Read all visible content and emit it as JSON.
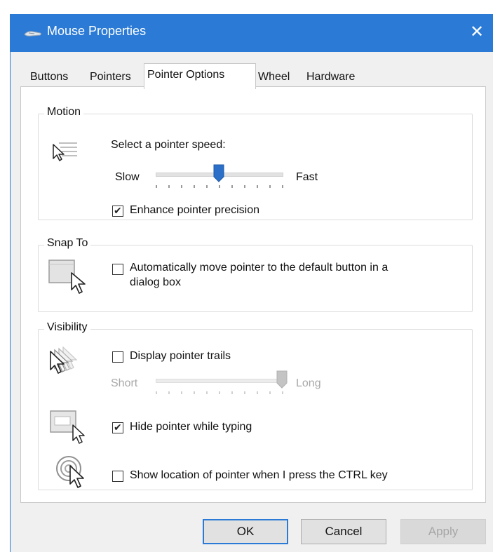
{
  "window": {
    "title": "Mouse Properties",
    "close_glyph": "✕"
  },
  "tabs": [
    {
      "label": "Buttons",
      "active": false
    },
    {
      "label": "Pointers",
      "active": false
    },
    {
      "label": "Pointer Options",
      "active": true
    },
    {
      "label": "Wheel",
      "active": false
    },
    {
      "label": "Hardware",
      "active": false
    }
  ],
  "motion": {
    "group_label": "Motion",
    "speed_prompt": "Select a pointer speed:",
    "slow_label": "Slow",
    "fast_label": "Fast",
    "speed_fraction": 0.5,
    "enhance_label": "Enhance pointer precision",
    "enhance_checked": true
  },
  "snap_to": {
    "group_label": "Snap To",
    "auto_move_label_line1": "Automatically move pointer to the default button in a",
    "auto_move_label_line2": "dialog box",
    "auto_move_checked": false
  },
  "visibility": {
    "group_label": "Visibility",
    "trails_label": "Display pointer trails",
    "trails_checked": false,
    "short_label": "Short",
    "long_label": "Long",
    "trail_length_fraction": 1.0,
    "hide_label": "Hide pointer while typing",
    "hide_checked": true,
    "ctrl_label": "Show location of pointer when I press the CTRL key",
    "ctrl_checked": false
  },
  "buttons": {
    "ok": "OK",
    "cancel": "Cancel",
    "apply": "Apply"
  },
  "colors": {
    "accent": "#2b7bd6",
    "thumb": "#2b6fc9",
    "disabled_thumb": "#c4c4c4"
  },
  "icons": [
    "mouse-icon",
    "close-icon",
    "pointer-speed-icon",
    "snap-to-icon",
    "pointer-trails-icon",
    "hide-pointer-icon",
    "ctrl-locate-icon",
    "checkmark-icon"
  ]
}
